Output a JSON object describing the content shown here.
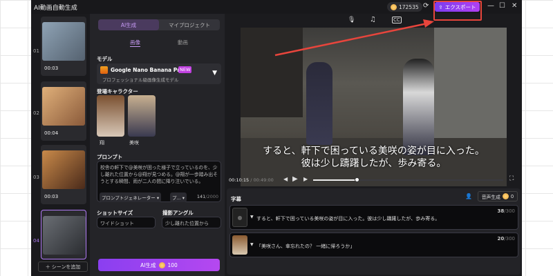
{
  "app": {
    "title": "AI動画自動生成",
    "coins": "172535",
    "export_label": "エクスポート"
  },
  "scenes": [
    {
      "num": "01",
      "duration": "00:03"
    },
    {
      "num": "02",
      "duration": "00:04"
    },
    {
      "num": "03",
      "duration": "00:03"
    },
    {
      "num": "04",
      "duration": ""
    }
  ],
  "add_scene": "＋ シーンを追加",
  "panel": {
    "tabs": [
      "AI生成",
      "マイプロジェクト"
    ],
    "subtabs": [
      "画像",
      "動画"
    ],
    "model_label": "モデル",
    "model_name": "Google Nano Banana Pro",
    "model_badge": "NEW",
    "model_desc": "プロフェッショナル級画像生成モデル",
    "characters_label": "登場キャラクター",
    "characters": [
      "翔",
      "美咲"
    ],
    "prompt_label": "プロンプト",
    "prompt": "校舎の軒下で@美咲が困った様子で立っているのを、少し離れた位置から@翔が見つめる。@翔が一歩踏み出そうとする瞬間、雨が二人の間に降り注いでいる。",
    "prompt_generator": "プロンプトジェネレーター ▾",
    "style_btn": "プ... ▾",
    "char_count": "141",
    "char_max": "/2000",
    "shot_size_label": "ショットサイズ",
    "shot_size": "ワイドショット",
    "angle_label": "撮影アングル",
    "angle": "少し離れた位置から",
    "generate_label": "AI生成",
    "generate_cost": "100"
  },
  "player": {
    "caption_line1": "すると、軒下で困っている美咲の姿が目に入った。",
    "caption_line2": "彼は少し躊躇したが、歩み寄る。",
    "current_time": "00:10:15",
    "total_time": " / 00:49:00",
    "progress": 0.23
  },
  "subtitles": {
    "label": "字幕",
    "voice_btn": "音声生成",
    "voice_cost": "0",
    "rows": [
      {
        "text": "すると、軒下で困っている美咲の姿が目に入った。彼は少し躊躇したが、歩み寄る。",
        "count": "38",
        "max": "/300"
      },
      {
        "text": "「美咲さん、傘忘れたの？ 一緒に帰ろうか」",
        "count": "20",
        "max": "/300"
      }
    ]
  },
  "colors": {
    "accent": "#9b45f2",
    "highlight": "#e8453c"
  }
}
